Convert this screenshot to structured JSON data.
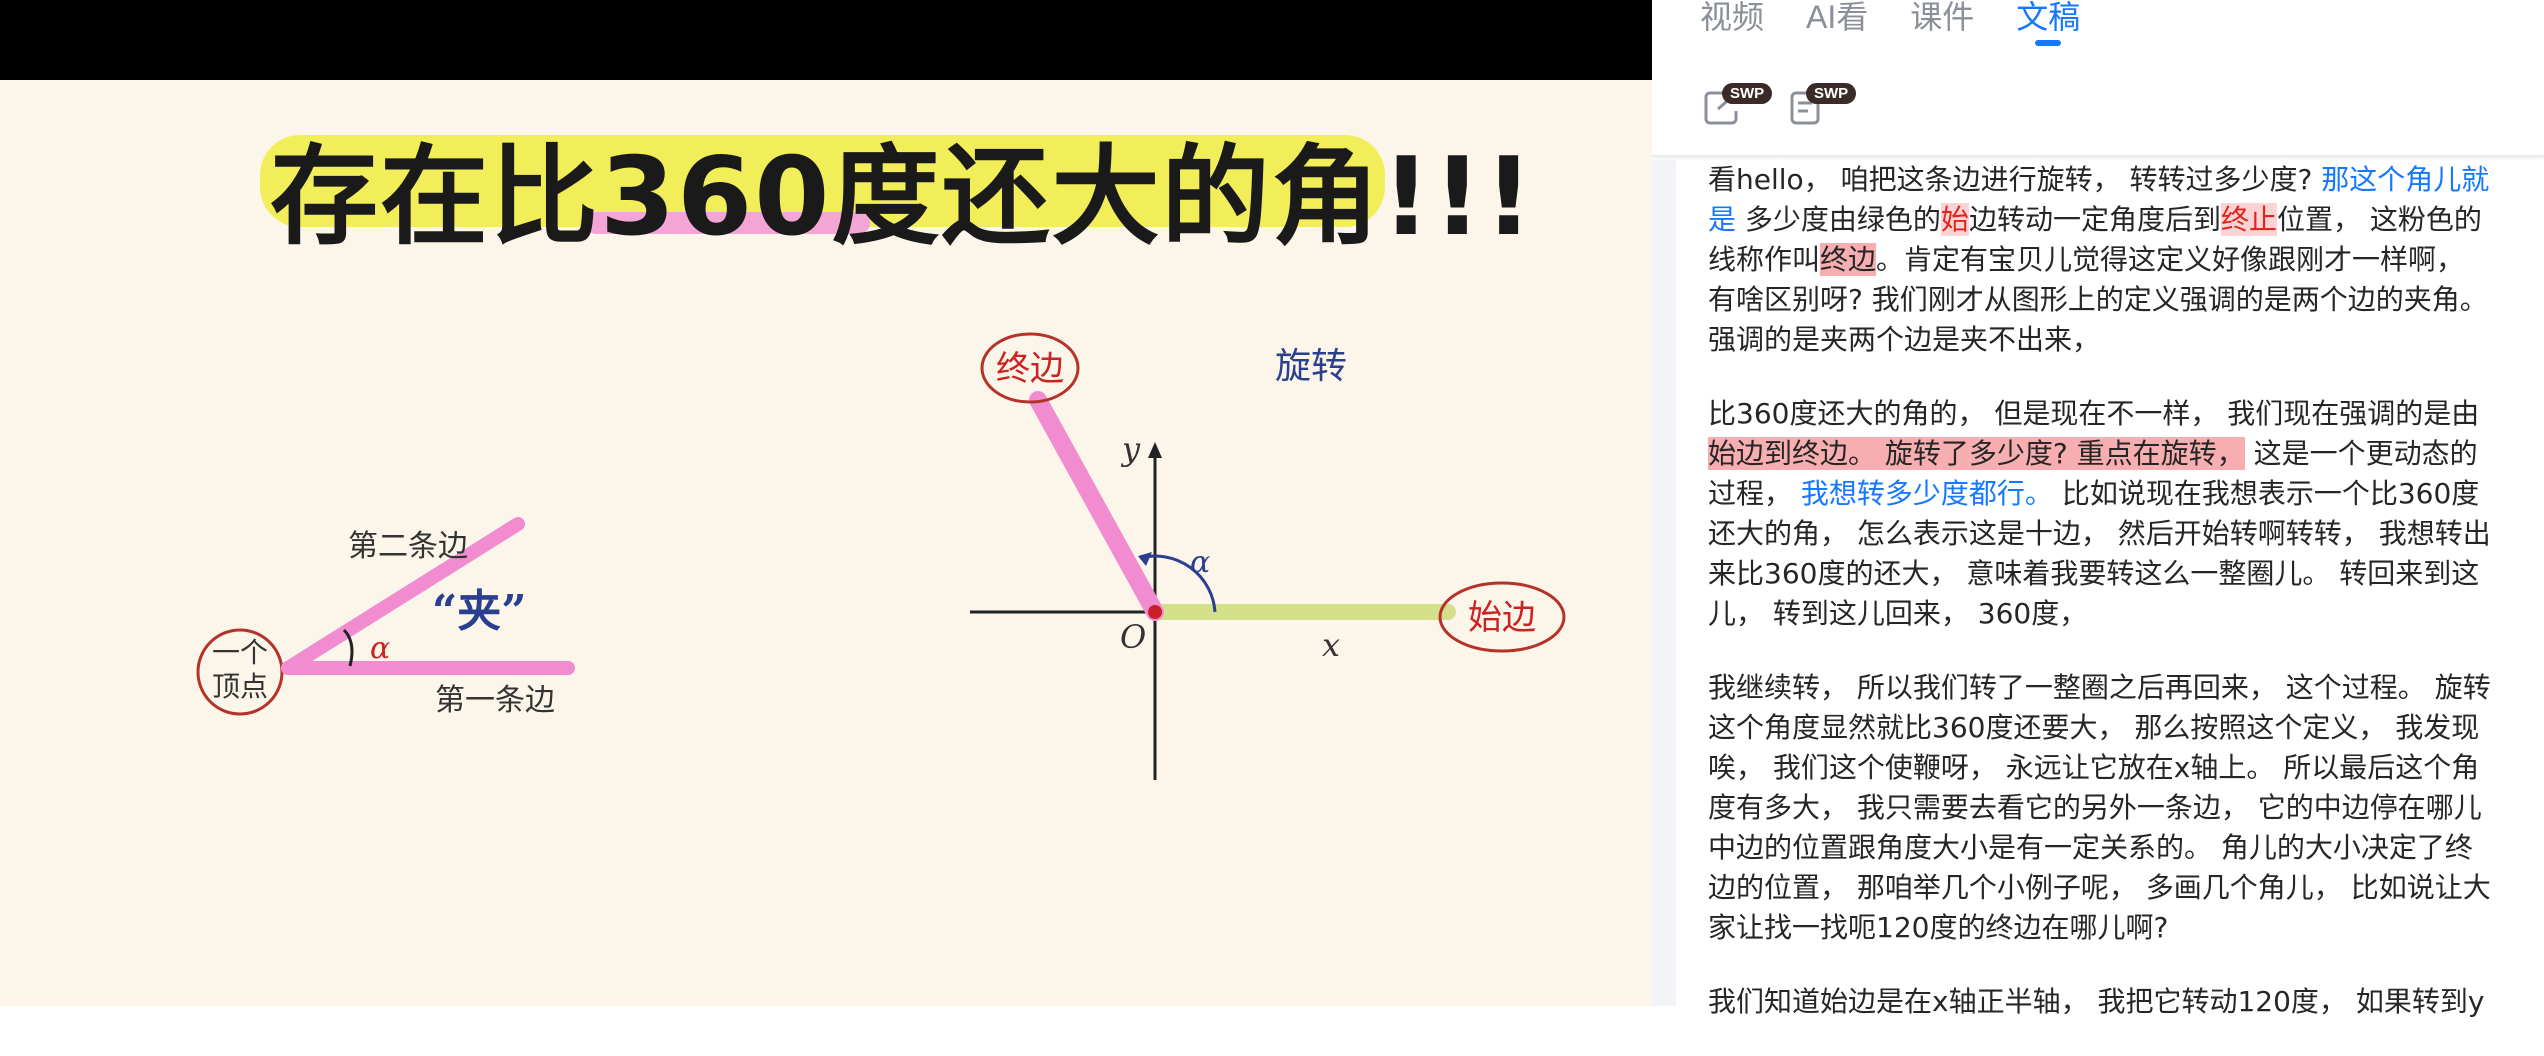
{
  "tabs": [
    {
      "label": "视频",
      "active": false
    },
    {
      "label": "AI看",
      "active": false
    },
    {
      "label": "课件",
      "active": false
    },
    {
      "label": "文稿",
      "active": true
    }
  ],
  "toolbar": {
    "badge1": "SWP",
    "badge2": "SWP",
    "icon1": "export-icon",
    "icon2": "notes-icon"
  },
  "slide": {
    "title": "存在比360度还大的角!!!",
    "left_diagram": {
      "vertex_label_1": "一个",
      "vertex_label_2": "顶点",
      "second_side": "第二条边",
      "first_side": "第一条边",
      "included": "“夹”",
      "alpha": "α"
    },
    "right_diagram": {
      "terminal_side": "终边",
      "rotate": "旋转",
      "initial_side": "始边",
      "y": "y",
      "x": "x",
      "origin": "O",
      "alpha": "α"
    }
  },
  "transcript": {
    "p1_a": "看hello， 咱把这条边进行旋转， 转转过多少度? ",
    "p1_b": "那这个角儿就是",
    "p1_c": "  多少度由绿色的",
    "p1_d": "始",
    "p1_e": "边转动一定角度后到",
    "p1_f": "终止",
    "p1_g": "位置， 这粉色的线称作叫",
    "p1_h": "终边",
    "p1_i": "。肯定有宝贝儿觉得这定义好像跟刚才一样啊， 有啥区别呀? 我们刚才从图形上的定义强调的是两个边的夹角。 强调的是夹两个边是夹不出来，",
    "p2_a": "比360度还大的角的， 但是现在不一样， 我们现在强调的是由",
    "p2_b": "始边到终边。 旋转了多少度? 重点在旋转，",
    "p2_c": " 这是一个更动态的过程， ",
    "p2_d": "我想转多少度都行。",
    "p2_e": " 比如说现在我想表示一个比360度还大的角， 怎么表示这是十边， 然后开始转啊转转， 我想转出来比360度的还大， 意味着我要转这么一整圈儿。 转回来到这儿， 转到这儿回来， 360度，",
    "p3": "我继续转， 所以我们转了一整圈之后再回来， 这个过程。 旋转这个角度显然就比360度还要大， 那么按照这个定义， 我发现唉， 我们这个使鞭呀， 永远让它放在x轴上。 所以最后这个角度有多大， 我只需要去看它的另外一条边， 它的中边停在哪儿中边的位置跟角度大小是有一定关系的。 角儿的大小决定了终边的位置， 那咱举几个小例子呢， 多画几个角儿， 比如说让大家让找一找呃120度的终边在哪儿啊?",
    "p4": "我们知道始边是在x轴正半轴， 我把它转动120度， 如果转到y"
  },
  "colors": {
    "accent": "#1677ff",
    "highlight_red": "#f6aeb0",
    "pink_side": "#f08ccf",
    "green_side": "#d4e08a",
    "title_highlight": "#f1ee5a"
  }
}
